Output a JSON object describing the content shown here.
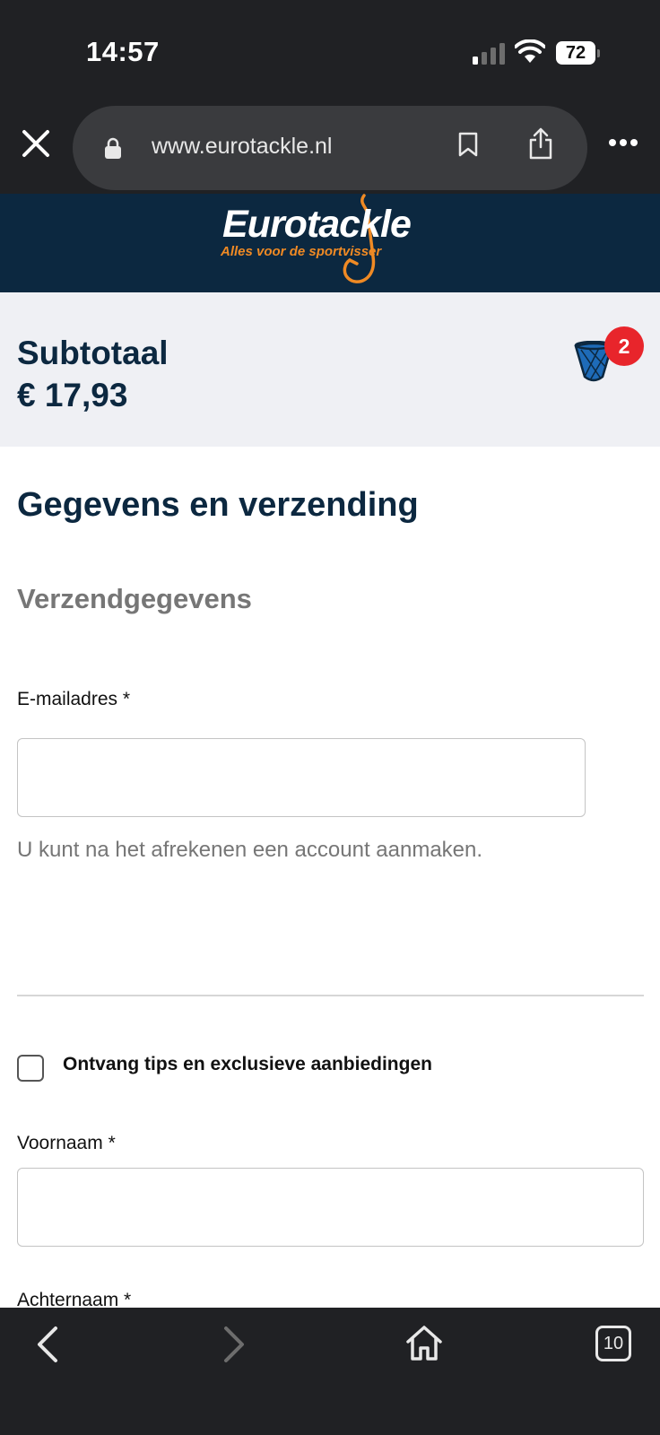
{
  "status_bar": {
    "time": "14:57",
    "battery": "72"
  },
  "browser": {
    "url": "www.eurotackle.nl",
    "tabs_count": "10"
  },
  "header": {
    "logo_text": "Eurotackle",
    "logo_tagline": "Alles voor de sportvisser",
    "brand_colors": {
      "navy": "#0c2840",
      "orange": "#f08a24"
    }
  },
  "cart": {
    "subtotal_label": "Subtotaal",
    "subtotal_amount": "€ 17,93",
    "item_count": "2",
    "icon": "fishing-net-icon"
  },
  "form": {
    "title": "Gegevens en verzending",
    "section_title": "Verzendgegevens",
    "email_label": "E-mailadres  *",
    "email_value": "",
    "email_helper": "U kunt na het afrekenen een account aanmaken.",
    "newsletter_label": "Ontvang tips en exclusieve aanbiedingen",
    "newsletter_checked": false,
    "firstname_label": "Voornaam  *",
    "firstname_value": "",
    "lastname_label": "Achternaam  *"
  }
}
